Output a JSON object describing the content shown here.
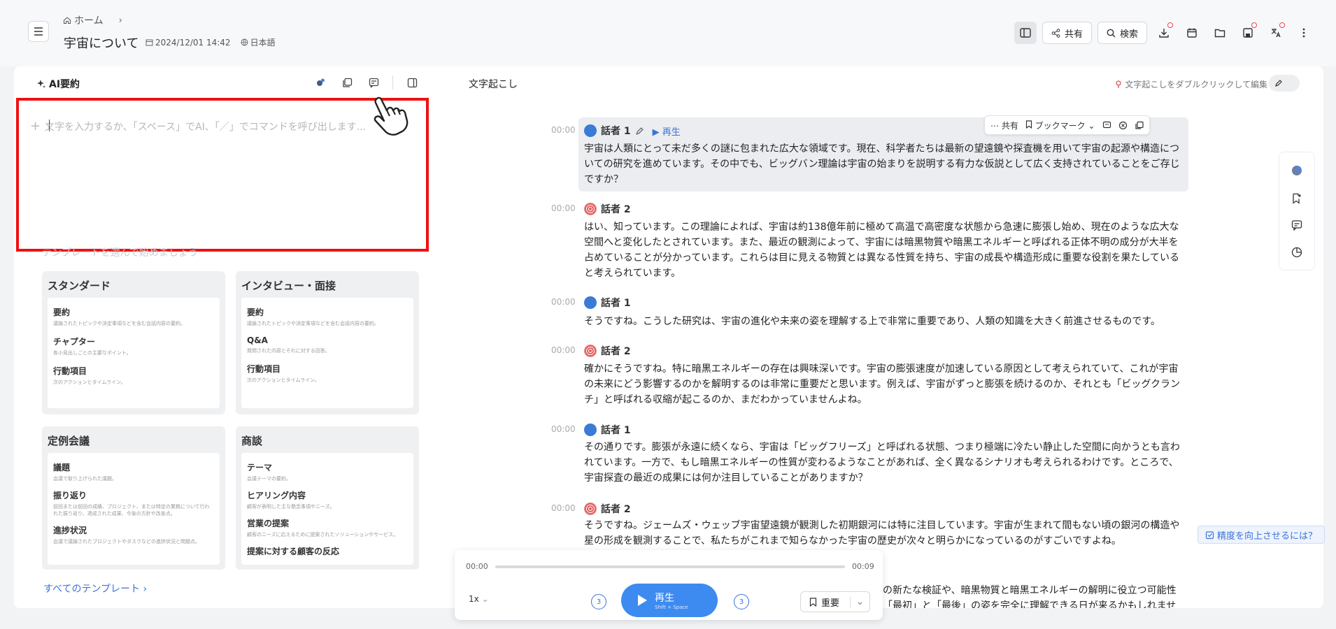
{
  "header": {
    "breadcrumb_home": "ホーム",
    "title": "宇宙について",
    "date": "2024/12/01 14:42",
    "language": "日本語",
    "share_label": "共有",
    "search_label": "検索"
  },
  "ai_panel": {
    "title": "AI要約",
    "editor_placeholder": "文字を入力するか、「スペース」でAI、「／」でコマンドを呼び出します...",
    "templates_title": "テンプレートを選んで始めましょう",
    "all_templates": "すべてのテンプレート",
    "templates": [
      {
        "name": "スタンダード",
        "items": [
          {
            "title": "要約",
            "desc": "議論されたトピックや決定事項などを含む会話内容の要約。"
          },
          {
            "title": "チャプター",
            "desc": "各小見出しごとの主要なポイント。"
          },
          {
            "title": "行動項目",
            "desc": "次のアクションとタイムライン。"
          }
        ]
      },
      {
        "name": "インタビュー・面接",
        "items": [
          {
            "title": "要約",
            "desc": "議論されたトピックや決定事項などを含む会話内容の要約。"
          },
          {
            "title": "Q&A",
            "desc": "質問された内容とそれに対する回答。"
          },
          {
            "title": "行動項目",
            "desc": "次のアクションとタイムライン。"
          }
        ]
      },
      {
        "name": "定例会議",
        "items": [
          {
            "title": "議題",
            "desc": "会議で取り上げられた議題。"
          },
          {
            "title": "振り返り",
            "desc": "前回または前回の成績、プロジェクト、または特定の業務について行われた振り返り、達成された成果、今後の方針や改善点。"
          },
          {
            "title": "進捗状況",
            "desc": "会議で議論されたプロジェクトやタスクなどの進捗状況と問題点。"
          }
        ]
      },
      {
        "name": "商談",
        "items": [
          {
            "title": "テーマ",
            "desc": "会議テーマの要約。"
          },
          {
            "title": "ヒアリング内容",
            "desc": "顧客が表明した主な懸念事項やニーズ。"
          },
          {
            "title": "営業の提案",
            "desc": "顧客のニーズに応えるために提案されたソリューションやサービス。"
          },
          {
            "title": "提案に対する顧客の反応",
            "desc": ""
          }
        ]
      }
    ]
  },
  "transcript": {
    "title": "文字起こし",
    "edit_hint": "文字起こしをダブルクリックして編集",
    "play_label": "再生",
    "float_share": "共有",
    "float_bookmark": "ブックマーク",
    "accuracy_label": "精度を向上させるには？",
    "segments": [
      {
        "time": "00:00",
        "speaker": "話者 1",
        "text": "宇宙は人類にとって未だ多くの謎に包まれた広大な領域です。現在、科学者たちは最新の望遠鏡や探査機を用いて宇宙の起源や構造についての研究を進めています。その中でも、ビッグバン理論は宇宙の始まりを説明する有力な仮説として広く支持されていることをご存じですか？"
      },
      {
        "time": "00:00",
        "speaker": "話者 2",
        "text": "はい、知っています。この理論によれば、宇宙は約138億年前に極めて高温で高密度な状態から急速に膨張し始め、現在のような広大な空間へと変化したとされています。また、最近の観測によって、宇宙には暗黒物質や暗黒エネルギーと呼ばれる正体不明の成分が大半を占めていることが分かっています。これらは目に見える物質とは異なる性質を持ち、宇宙の成長や構造形成に重要な役割を果たしていると考えられています。"
      },
      {
        "time": "00:00",
        "speaker": "話者 1",
        "text": "そうですね。こうした研究は、宇宙の進化や未来の姿を理解する上で非常に重要であり、人類の知識を大きく前進させるものです。"
      },
      {
        "time": "00:00",
        "speaker": "話者 2",
        "text": "確かにそうですね。特に暗黒エネルギーの存在は興味深いです。宇宙の膨張速度が加速している原因として考えられていて、これが宇宙の未来にどう影響するのかを解明するのは非常に重要だと思います。例えば、宇宙がずっと膨張を続けるのか、それとも「ビッグクランチ」と呼ばれる収縮が起こるのか、まだわかっていませんよね。"
      },
      {
        "time": "00:00",
        "speaker": "話者 1",
        "text": "その通りです。膨張が永遠に続くなら、宇宙は「ビッグフリーズ」と呼ばれる状態、つまり極端に冷たい静止した空間に向かうとも言われています。一方で、もし暗黒エネルギーの性質が変わるようなことがあれば、全く異なるシナリオも考えられるわけです。ところで、宇宙探査の最近の成果には何か注目していることがありますか？"
      },
      {
        "time": "00:00",
        "speaker": "話者 2",
        "text": "そうですね。ジェームズ・ウェッブ宇宙望遠鏡が観測した初期銀河には特に注目しています。宇宙が生まれて間もない頃の銀河の構造や星の形成を観測することで、私たちがこれまで知らなかった宇宙の歴史が次々と明らかになっているのがすごいですよね。"
      }
    ],
    "tail_line_1": "の新たな検証や、暗黒物質と暗黒エネルギーの解明に役立つ可能性",
    "tail_line_2": "「最初」と「最後」の姿を完全に理解できる日が来るかもしれませ"
  },
  "player": {
    "current": "00:00",
    "total": "00:09",
    "progress": 0.0,
    "speed": "1x",
    "play_label": "再生",
    "play_shortcut": "Shift + Space",
    "skip_back": "3",
    "skip_fwd": "3",
    "important_label": "重要"
  },
  "colors": {
    "accent": "#3d8bf0",
    "highlight_box": "#ee1111",
    "notify_dot": "#e5484d"
  }
}
